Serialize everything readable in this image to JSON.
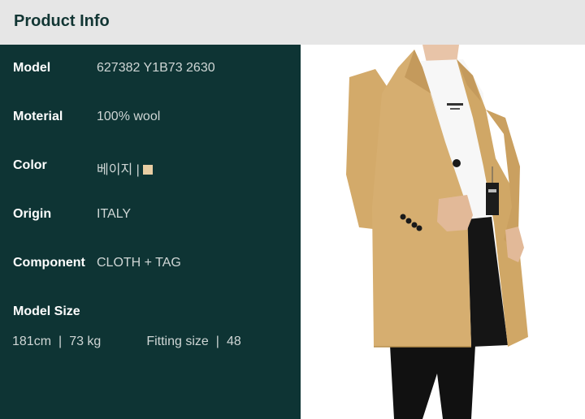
{
  "header": {
    "title": "Product Info"
  },
  "specs": [
    {
      "label": "Model",
      "value": "627382 Y1B73 2630"
    },
    {
      "label": "Moterial",
      "value": "100% wool"
    },
    {
      "label": "Color",
      "value": "베이지 |"
    },
    {
      "label": "Origin",
      "value": "ITALY"
    },
    {
      "label": "Component",
      "value": "CLOTH + TAG"
    }
  ],
  "model_size": {
    "label": "Model Size",
    "height": "181cm",
    "weight": "73 kg",
    "fitting_label": "Fitting size",
    "fitting_value": "48",
    "separator": "|"
  },
  "colors": {
    "swatch": "#e8cda3",
    "panel": "#0e3434",
    "header_bg": "#e6e6e6"
  }
}
